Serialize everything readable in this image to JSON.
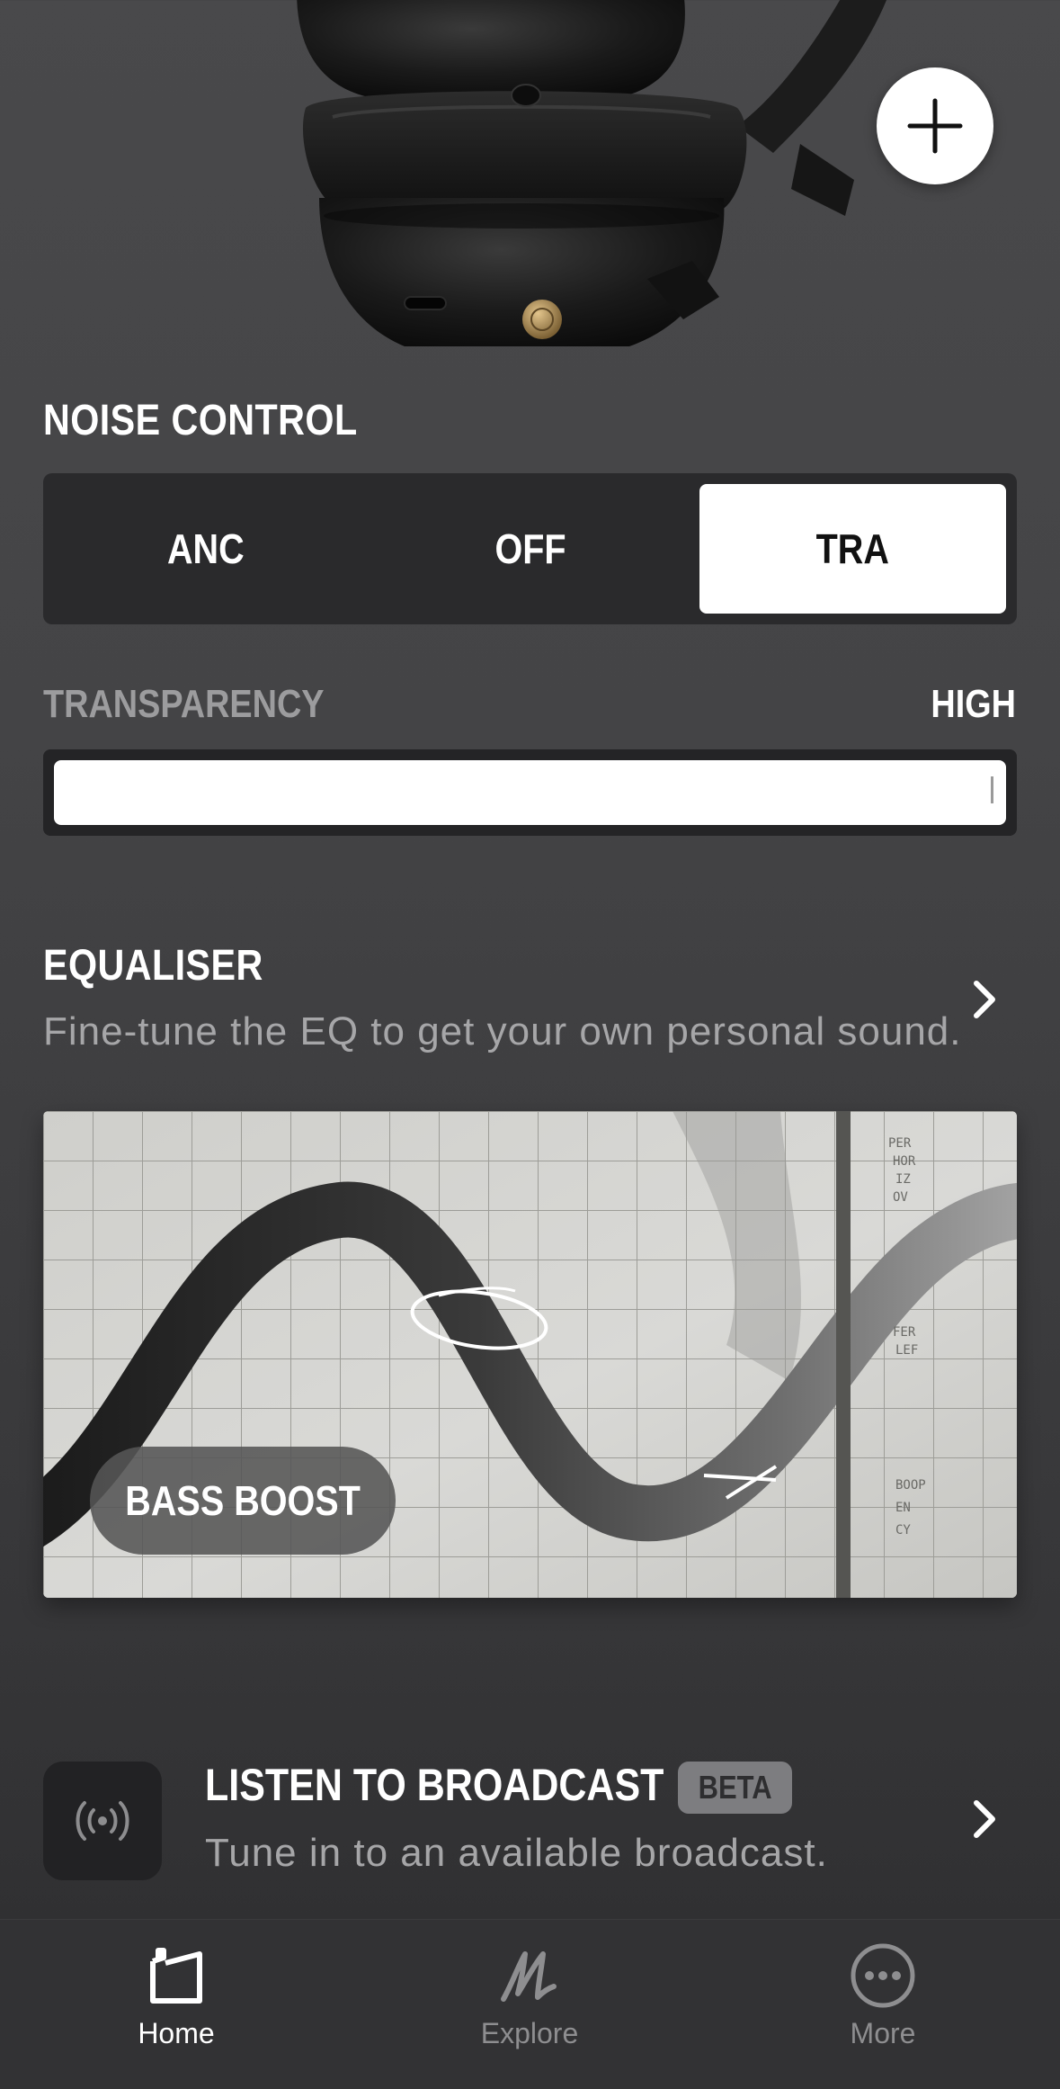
{
  "noise_control": {
    "title": "NOISE CONTROL",
    "options": [
      "ANC",
      "OFF",
      "TRA"
    ],
    "selected": "TRA"
  },
  "transparency": {
    "label": "TRANSPARENCY",
    "value": "HIGH",
    "level": 1.0
  },
  "equaliser": {
    "title": "EQUALISER",
    "subtitle": "Fine-tune the EQ to get your own personal sound.",
    "preset": "BASS BOOST"
  },
  "broadcast": {
    "title": "LISTEN TO BROADCAST",
    "badge": "BETA",
    "subtitle": "Tune in to an available broadcast."
  },
  "tabs": [
    {
      "label": "Home",
      "icon": "home-icon",
      "active": true
    },
    {
      "label": "Explore",
      "icon": "marshall-m-icon",
      "active": false
    },
    {
      "label": "More",
      "icon": "more-icon",
      "active": false
    }
  ],
  "colors": {
    "background": "#444446",
    "accent": "#ffffff",
    "muted_text": "#a6a6a8",
    "tab_inactive": "#8e8e90",
    "speaker_knob": "#a88a5a"
  }
}
